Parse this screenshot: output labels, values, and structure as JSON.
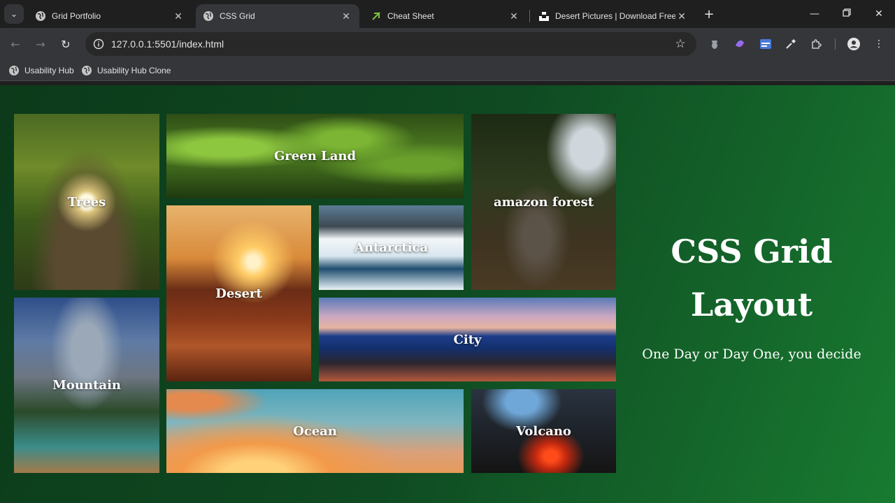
{
  "browser": {
    "tabs": [
      {
        "title": "Grid Portfolio",
        "active": false
      },
      {
        "title": "CSS Grid",
        "active": true
      },
      {
        "title": "Cheat Sheet",
        "active": false
      },
      {
        "title": "Desert Pictures | Download Free In",
        "active": false
      }
    ],
    "url": "127.0.0.1:5501/index.html",
    "bookmarks": [
      "Usability Hub",
      "Usability Hub Clone"
    ]
  },
  "gallery": {
    "tiles": [
      {
        "label": "Trees"
      },
      {
        "label": "Green Land"
      },
      {
        "label": "amazon forest"
      },
      {
        "label": "Desert"
      },
      {
        "label": "Antarctica"
      },
      {
        "label": "Mountain"
      },
      {
        "label": "City"
      },
      {
        "label": "Ocean"
      },
      {
        "label": "Volcano"
      }
    ]
  },
  "hero": {
    "title_line1": "CSS Grid",
    "title_line2": "Layout",
    "subtitle": "One Day or Day One, you decide"
  },
  "colors": {
    "page_bg_dark": "#0c3a1a",
    "page_bg_light": "#187a30",
    "chrome_bg": "#1f1f1f",
    "toolbar_bg": "#35363a",
    "text": "#ffffff"
  }
}
